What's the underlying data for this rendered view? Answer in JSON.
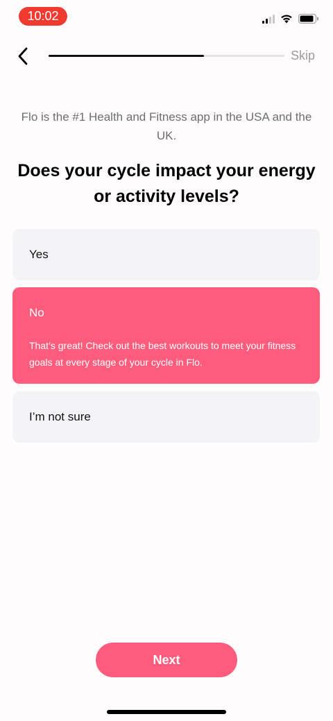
{
  "status_bar": {
    "time": "10:02"
  },
  "nav": {
    "skip_label": "Skip",
    "progress_fraction": 0.66
  },
  "content": {
    "subtitle": "Flo is the #1 Health and Fitness app in the USA and the UK.",
    "question": "Does your cycle impact your energy or activity levels?"
  },
  "options": [
    {
      "label": "Yes",
      "selected": false
    },
    {
      "label": "No",
      "selected": true,
      "feedback": "That’s great! Check out the best workouts to meet your fitness goals at every stage of your cycle in Flo."
    },
    {
      "label": "I’m not sure",
      "selected": false
    }
  ],
  "footer": {
    "next_label": "Next"
  },
  "colors": {
    "accent": "#fe5c7d",
    "time_pill": "#f03a2f",
    "option_bg": "#f4f3f6"
  }
}
